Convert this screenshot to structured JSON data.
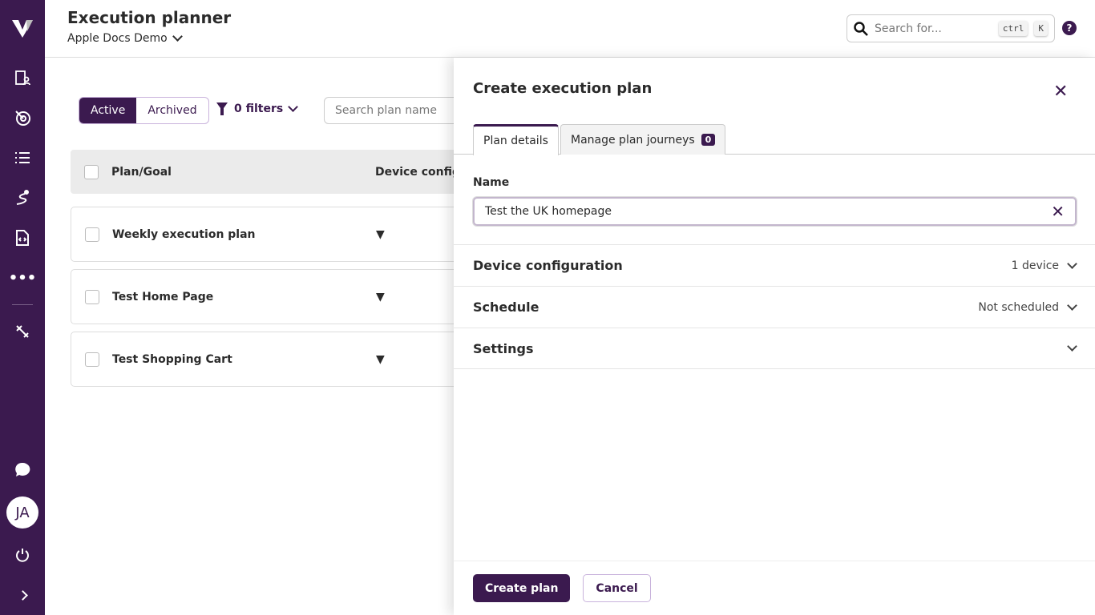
{
  "colors": {
    "brand": "#3b1a4f"
  },
  "sidebar": {
    "items": [
      {
        "name": "logo",
        "icon": "v-logo-icon"
      },
      {
        "name": "organization",
        "icon": "building-user-icon"
      },
      {
        "name": "goals",
        "icon": "target-icon"
      },
      {
        "name": "list",
        "icon": "list-icon"
      },
      {
        "name": "journeys",
        "icon": "route-icon"
      },
      {
        "name": "code",
        "icon": "code-file-icon"
      },
      {
        "name": "more",
        "icon": "more-icon"
      },
      {
        "name": "tools",
        "icon": "tools-icon"
      }
    ],
    "avatar": "JA"
  },
  "header": {
    "title": "Execution planner",
    "workspace": "Apple Docs Demo",
    "search_placeholder": "Search for...",
    "kbd1": "ctrl",
    "kbd2": "K",
    "help": "?"
  },
  "main": {
    "segments": [
      "Active",
      "Archived"
    ],
    "filters": "0 filters",
    "search_placeholder": "Search plan name",
    "columns": [
      "Plan/Goal",
      "Device configu"
    ],
    "rows": [
      "Weekly execution plan",
      "Test Home Page",
      "Test Shopping Cart"
    ]
  },
  "panel": {
    "title": "Create execution plan",
    "tabs": [
      {
        "label": "Plan details"
      },
      {
        "label": "Manage plan journeys",
        "count": "0"
      }
    ],
    "name_label": "Name",
    "name_value": "Test the UK homepage",
    "sections": [
      {
        "title": "Device configuration",
        "value": "1 device"
      },
      {
        "title": "Schedule",
        "value": "Not scheduled"
      },
      {
        "title": "Settings",
        "value": ""
      }
    ],
    "create": "Create plan",
    "cancel": "Cancel"
  }
}
